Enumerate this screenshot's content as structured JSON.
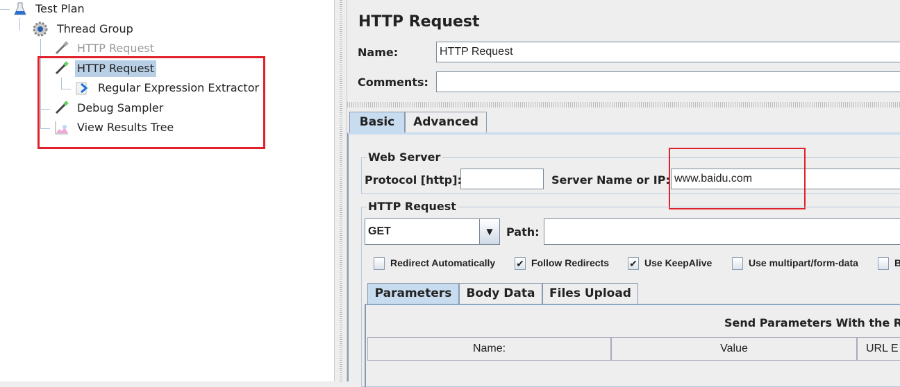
{
  "tree": {
    "items": [
      {
        "label": "Test Plan",
        "icon": "flask-icon"
      },
      {
        "label": "Thread Group",
        "icon": "gear-icon"
      },
      {
        "label": "HTTP Request",
        "icon": "pipette-icon",
        "disabled": true
      },
      {
        "label": "HTTP Request",
        "icon": "pipette-icon",
        "selected": true
      },
      {
        "label": "Regular Expression Extractor",
        "icon": "arrow-doc-icon"
      },
      {
        "label": "Debug Sampler",
        "icon": "pipette-icon"
      },
      {
        "label": "View Results Tree",
        "icon": "graph-icon"
      }
    ]
  },
  "panel": {
    "title": "HTTP Request",
    "name_label": "Name:",
    "name_value": "HTTP Request",
    "comments_label": "Comments:",
    "comments_value": "",
    "tabs": [
      "Basic",
      "Advanced"
    ],
    "web_server": {
      "legend": "Web Server",
      "protocol_label": "Protocol [http]:",
      "protocol_value": "",
      "server_label": "Server Name or IP:",
      "server_value": "www.baidu.com"
    },
    "http_request": {
      "legend": "HTTP Request",
      "method": "GET",
      "path_label": "Path:",
      "path_value": "",
      "checkboxes": [
        {
          "label": "Redirect Automatically",
          "checked": false
        },
        {
          "label": "Follow Redirects",
          "checked": true
        },
        {
          "label": "Use KeepAlive",
          "checked": true
        },
        {
          "label": "Use multipart/form-data",
          "checked": false
        },
        {
          "label": "B",
          "checked": false
        }
      ]
    },
    "sub_tabs": [
      "Parameters",
      "Body Data",
      "Files Upload"
    ],
    "params_title": "Send Parameters With the Re",
    "columns": [
      "Name:",
      "Value",
      "URL E"
    ]
  },
  "highlight_color": "#e0202a"
}
